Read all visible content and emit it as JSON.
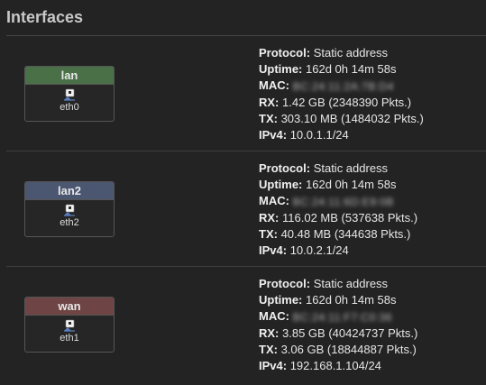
{
  "title": "Interfaces",
  "labels": {
    "protocol": "Protocol:",
    "uptime": "Uptime:",
    "mac": "MAC:",
    "rx": "RX:",
    "tx": "TX:",
    "ipv4": "IPv4:"
  },
  "interfaces": [
    {
      "name": "lan",
      "device": "eth0",
      "header_color": "#4a7048",
      "icon": "ethernet-port-icon",
      "protocol": "Static address",
      "uptime": "162d 0h 14m 58s",
      "mac": "BC:24:11:2A:7B:D4",
      "rx": "1.42 GB (2348390 Pkts.)",
      "tx": "303.10 MB (1484032 Pkts.)",
      "ipv4": "10.0.1.1/24"
    },
    {
      "name": "lan2",
      "device": "eth2",
      "header_color": "#4b5670",
      "icon": "ethernet-port-icon",
      "protocol": "Static address",
      "uptime": "162d 0h 14m 58s",
      "mac": "BC:24:11:6D:E9:0B",
      "rx": "116.02 MB (537638 Pkts.)",
      "tx": "40.48 MB (344638 Pkts.)",
      "ipv4": "10.0.2.1/24"
    },
    {
      "name": "wan",
      "device": "eth1",
      "header_color": "#6e4444",
      "icon": "ethernet-port-icon",
      "protocol": "Static address",
      "uptime": "162d 0h 14m 58s",
      "mac": "BC:24:11:F7:C0:36",
      "rx": "3.85 GB (40424737 Pkts.)",
      "tx": "3.06 GB (18844887 Pkts.)",
      "ipv4": "192.168.1.104/24"
    }
  ]
}
